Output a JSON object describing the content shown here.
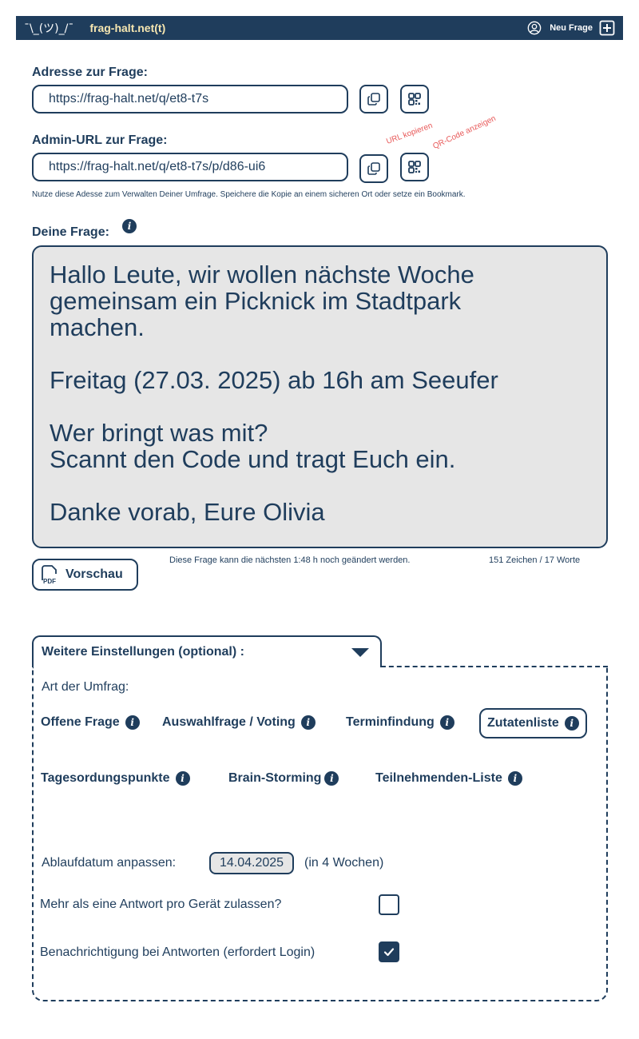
{
  "header": {
    "shrug": "¯\\_(ツ)_/¯",
    "brand": "frag-halt.net(t)",
    "new_question": "Neu Frage"
  },
  "address": {
    "label": "Adresse zur Frage:",
    "url": "https://frag-halt.net/q/et8-t7s"
  },
  "admin": {
    "label": "Admin-URL zur Frage:",
    "url": "https://frag-halt.net/q/et8-t7s/p/d86-ui6",
    "note": "Nutze diese Adesse zum Verwalten Deiner Umfrage. Speichere die Kopie an einem sicheren Ort oder setze ein Bookmark."
  },
  "hints": {
    "copy_url": "URL kopieren",
    "show_qr": "QR-Code anzeigen"
  },
  "question": {
    "label": "Deine Frage:",
    "text": "Hallo Leute, wir wollen nächste Woche\ngemeinsam ein Picknick im Stadtpark\nmachen.\n\nFreitag (27.03. 2025) ab 16h am Seeufer\n\nWer bringt was mit?\nScannt den Code und tragt Euch ein.\n\nDanke vorab, Eure Olivia",
    "edit_note": "Diese Frage kann die nächsten 1:48 h noch geändert werden.",
    "counter": "151 Zeichen / 17 Worte",
    "preview_label": "Vorschau",
    "pdf_text": "PDF"
  },
  "settings": {
    "title": "Weitere Einstellungen (optional) :",
    "survey_type_label": "Art der Umfrag:",
    "types": [
      {
        "label": "Offene Frage",
        "selected": false
      },
      {
        "label": "Auswahlfrage / Voting",
        "selected": false
      },
      {
        "label": "Terminfindung",
        "selected": false
      },
      {
        "label": "Zutatenliste",
        "selected": true
      },
      {
        "label": "Tagesordungspunkte",
        "selected": false
      },
      {
        "label": "Brain-Storming",
        "selected": false
      },
      {
        "label": "Teilnehmenden-Liste",
        "selected": false
      }
    ],
    "expiry_label": "Ablaufdatum anpassen:",
    "expiry_date": "14.04.2025",
    "expiry_hint": "(in 4 Wochen)",
    "multi_answer_label": "Mehr als eine Antwort pro Gerät zulassen?",
    "multi_answer_checked": false,
    "notify_label": "Benachrichtigung bei Antworten (erfordert Login)",
    "notify_checked": true
  },
  "colors": {
    "primary": "#1f3d5c",
    "brand": "#f6e6b0",
    "hint": "#e85a5a",
    "field_bg": "#e6e6e6"
  }
}
